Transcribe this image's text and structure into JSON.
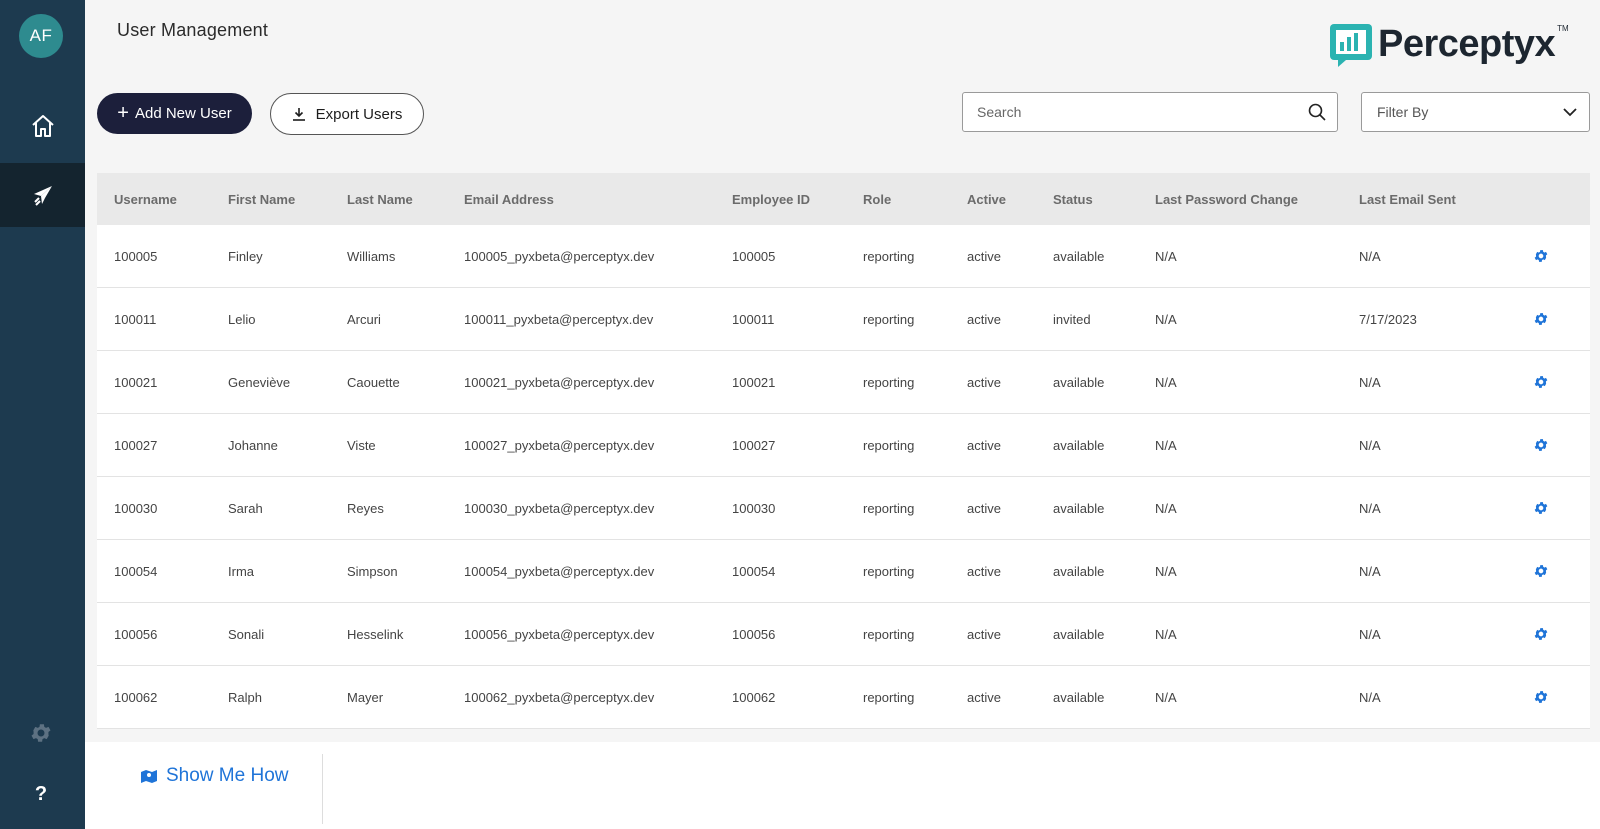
{
  "user": {
    "initials": "AF"
  },
  "header": {
    "title": "User Management",
    "logo_text": "Perceptyx",
    "logo_tm": "TM"
  },
  "toolbar": {
    "add_label": "Add New User",
    "export_label": "Export Users",
    "search_placeholder": "Search",
    "filter_label": "Filter By"
  },
  "table": {
    "columns": [
      "Username",
      "First Name",
      "Last Name",
      "Email Address",
      "Employee ID",
      "Role",
      "Active",
      "Status",
      "Last Password Change",
      "Last Email Sent"
    ],
    "rows": [
      [
        "100005",
        "Finley",
        "Williams",
        "100005_pyxbeta@perceptyx.dev",
        "100005",
        "reporting",
        "active",
        "available",
        "N/A",
        "N/A"
      ],
      [
        "100011",
        "Lelio",
        "Arcuri",
        "100011_pyxbeta@perceptyx.dev",
        "100011",
        "reporting",
        "active",
        "invited",
        "N/A",
        "7/17/2023"
      ],
      [
        "100021",
        "Geneviève",
        "Caouette",
        "100021_pyxbeta@perceptyx.dev",
        "100021",
        "reporting",
        "active",
        "available",
        "N/A",
        "N/A"
      ],
      [
        "100027",
        "Johanne",
        "Viste",
        "100027_pyxbeta@perceptyx.dev",
        "100027",
        "reporting",
        "active",
        "available",
        "N/A",
        "N/A"
      ],
      [
        "100030",
        "Sarah",
        "Reyes",
        "100030_pyxbeta@perceptyx.dev",
        "100030",
        "reporting",
        "active",
        "available",
        "N/A",
        "N/A"
      ],
      [
        "100054",
        "Irma",
        "Simpson",
        "100054_pyxbeta@perceptyx.dev",
        "100054",
        "reporting",
        "active",
        "available",
        "N/A",
        "N/A"
      ],
      [
        "100056",
        "Sonali",
        "Hesselink",
        "100056_pyxbeta@perceptyx.dev",
        "100056",
        "reporting",
        "active",
        "available",
        "N/A",
        "N/A"
      ],
      [
        "100062",
        "Ralph",
        "Mayer",
        "100062_pyxbeta@perceptyx.dev",
        "100062",
        "reporting",
        "active",
        "available",
        "N/A",
        "N/A"
      ]
    ]
  },
  "footer": {
    "show_me_how": "Show Me How"
  },
  "colors": {
    "sidebar": "#1d3a4f",
    "accent": "#1f74d8",
    "primary_button": "#1c1f3b",
    "logo_mark": "#2bb3b1"
  }
}
